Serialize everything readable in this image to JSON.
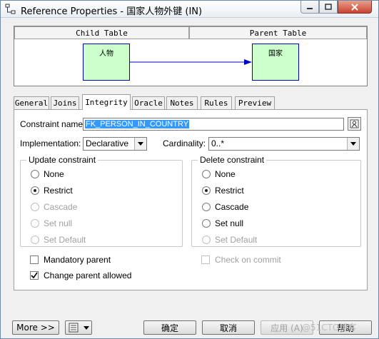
{
  "window": {
    "title": "Reference Properties - 国家人物外键 (IN)",
    "controls": {
      "minimize": "▭",
      "maximize": "□",
      "close": "✕"
    }
  },
  "diagram": {
    "child_header": "Child Table",
    "parent_header": "Parent Table",
    "child_entity": "人物",
    "parent_entity": "国家"
  },
  "tabs": [
    {
      "label": "General"
    },
    {
      "label": "Joins"
    },
    {
      "label": "Integrity",
      "active": true
    },
    {
      "label": "Oracle"
    },
    {
      "label": "Notes"
    },
    {
      "label": "Rules"
    },
    {
      "label": "Preview"
    }
  ],
  "form": {
    "constraint_name_label": "Constraint name:",
    "constraint_name_value": "FK_PERSON_IN_COUNTRY",
    "implementation_label": "Implementation:",
    "implementation_value": "Declarative",
    "cardinality_label": "Cardinality:",
    "cardinality_value": "0..*"
  },
  "update_constraint": {
    "title": "Update constraint",
    "options": [
      {
        "label": "None",
        "checked": false,
        "enabled": true
      },
      {
        "label": "Restrict",
        "checked": true,
        "enabled": true
      },
      {
        "label": "Cascade",
        "checked": false,
        "enabled": false
      },
      {
        "label": "Set null",
        "checked": false,
        "enabled": false
      },
      {
        "label": "Set Default",
        "checked": false,
        "enabled": false
      }
    ]
  },
  "delete_constraint": {
    "title": "Delete constraint",
    "options": [
      {
        "label": "None",
        "checked": false,
        "enabled": true
      },
      {
        "label": "Restrict",
        "checked": true,
        "enabled": true
      },
      {
        "label": "Cascade",
        "checked": false,
        "enabled": true
      },
      {
        "label": "Set null",
        "checked": false,
        "enabled": true
      },
      {
        "label": "Set Default",
        "checked": false,
        "enabled": false
      }
    ]
  },
  "checks": {
    "mandatory_parent": {
      "label": "Mandatory parent",
      "checked": false
    },
    "change_parent_allowed": {
      "label": "Change parent allowed",
      "checked": true
    },
    "check_on_commit": {
      "label": "Check on commit",
      "checked": false,
      "enabled": false
    }
  },
  "buttons": {
    "more": "More >>",
    "ok": "确定",
    "cancel": "取消",
    "apply": "应用 (A)",
    "help": "帮助"
  },
  "watermark": "@51CTO博客"
}
